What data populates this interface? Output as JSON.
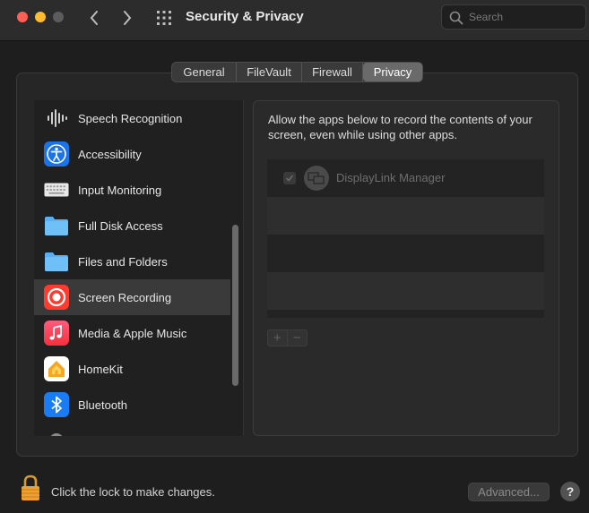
{
  "window": {
    "title": "Security & Privacy",
    "search_placeholder": "Search"
  },
  "tabs": [
    {
      "label": "General",
      "selected": false
    },
    {
      "label": "FileVault",
      "selected": false
    },
    {
      "label": "Firewall",
      "selected": false
    },
    {
      "label": "Privacy",
      "selected": true
    }
  ],
  "sidebar": {
    "items": [
      {
        "label": "Speech Recognition",
        "icon": "waveform-icon",
        "selected": false
      },
      {
        "label": "Accessibility",
        "icon": "accessibility-icon",
        "selected": false
      },
      {
        "label": "Input Monitoring",
        "icon": "keyboard-icon",
        "selected": false
      },
      {
        "label": "Full Disk Access",
        "icon": "folder-icon",
        "selected": false
      },
      {
        "label": "Files and Folders",
        "icon": "folder-icon",
        "selected": false
      },
      {
        "label": "Screen Recording",
        "icon": "record-icon",
        "selected": true
      },
      {
        "label": "Media & Apple Music",
        "icon": "music-icon",
        "selected": false
      },
      {
        "label": "HomeKit",
        "icon": "home-icon",
        "selected": false
      },
      {
        "label": "Bluetooth",
        "icon": "bluetooth-icon",
        "selected": false
      }
    ]
  },
  "content": {
    "description": "Allow the apps below to record the contents of your screen, even while using other apps.",
    "apps": [
      {
        "name": "DisplayLink Manager",
        "checked": true,
        "enabled": false
      }
    ],
    "add_label": "+",
    "remove_label": "−"
  },
  "footer": {
    "lock_text": "Click the lock to make changes.",
    "advanced_label": "Advanced...",
    "help_label": "?"
  },
  "colors": {
    "record": "#ff3b30",
    "accessibility": "#1a73e8",
    "folder": "#5ab0f0",
    "music": "#fa3c4c",
    "bluetooth": "#1a7cf5",
    "lock": "#f0a030"
  }
}
